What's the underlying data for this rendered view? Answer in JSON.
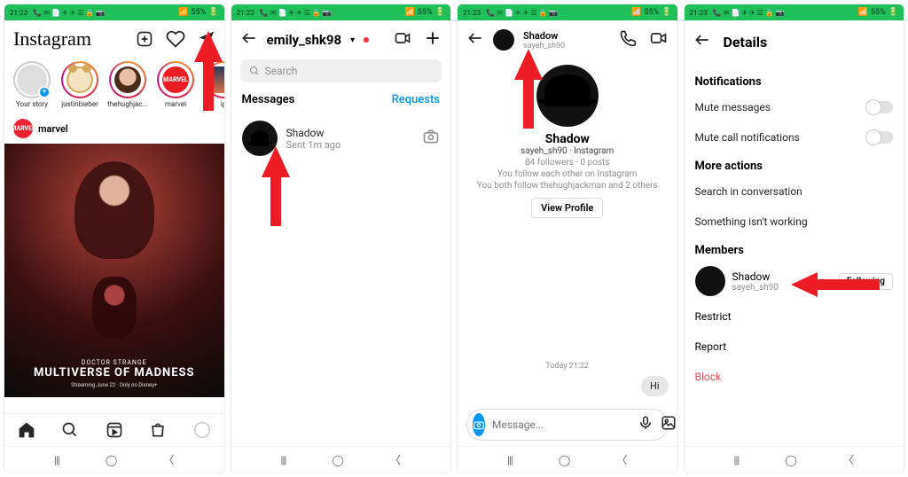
{
  "status": {
    "time": "21:23",
    "battery": "55%",
    "icons": "📞 ✉ 📄 ✈ ✈ ☰ 🔒 📷"
  },
  "phone1": {
    "logo": "Instagram",
    "stories": [
      {
        "label": "Your story"
      },
      {
        "label": "justinbieber"
      },
      {
        "label": "thehughjac..."
      },
      {
        "label": "marvel"
      },
      {
        "label": "ip"
      }
    ],
    "post": {
      "user": "marvel",
      "sub": "DOCTOR STRANGE",
      "title": "MULTIVERSE OF MADNESS",
      "date": "Streaming June 22 · Only on Disney+",
      "avatar_text": "MARVEL"
    }
  },
  "phone2": {
    "user": "emily_shk98",
    "search_placeholder": "Search",
    "tab_messages": "Messages",
    "tab_requests": "Requests",
    "msg": {
      "name": "Shadow",
      "sub": "Sent 1m ago"
    }
  },
  "phone3": {
    "header": {
      "name": "Shadow",
      "sub": "sayeh_sh90"
    },
    "profile": {
      "name": "Shadow",
      "sub": "sayeh_sh90 · Instagram",
      "info1": "84 followers · 0 posts",
      "info2": "You follow each other on Instagram",
      "info3": "You both follow thehughjackman and 2 others",
      "button": "View Profile"
    },
    "chat": {
      "time": "Today 21:22",
      "bubble": "Hi",
      "placeholder": "Message..."
    }
  },
  "phone4": {
    "title": "Details",
    "sections": {
      "notifications": "Notifications",
      "mute_msg": "Mute messages",
      "mute_call": "Mute call notifications",
      "more": "More actions",
      "search": "Search in conversation",
      "notworking": "Something isn't working",
      "members": "Members",
      "member": {
        "name": "Shadow",
        "sub": "sayeh_sh90",
        "button": "Following"
      },
      "restrict": "Restrict",
      "report": "Report",
      "block": "Block"
    }
  }
}
